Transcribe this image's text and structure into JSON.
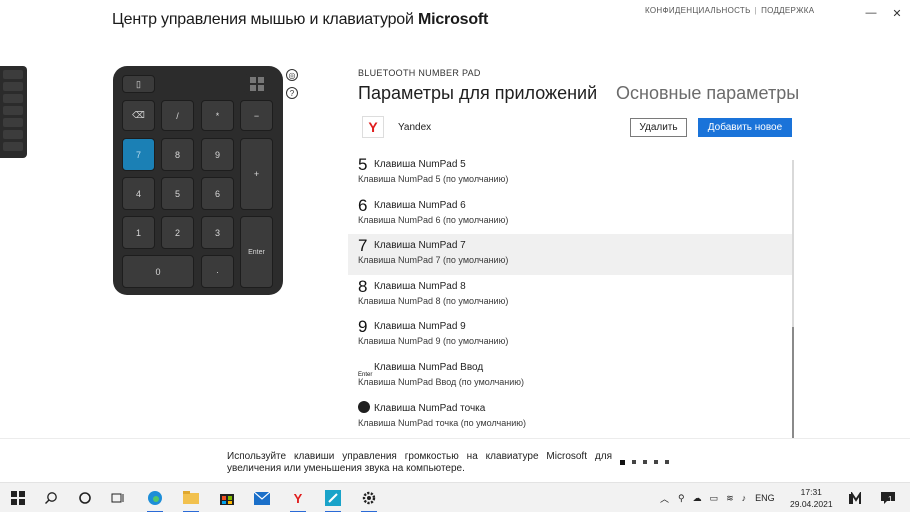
{
  "window": {
    "title_prefix": "Центр управления мышью и клавиатурой",
    "title_brand": "Microsoft",
    "link_privacy": "КОНФИДЕНЦИАЛЬНОСТЬ",
    "link_support": "ПОДДЕРЖКА",
    "min_glyph": "—",
    "close_glyph": "✕"
  },
  "device": {
    "name": "BLUETOOTH NUMBER PAD",
    "keys": {
      "backspace": "⌫",
      "divide": "/",
      "multiply": "*",
      "minus": "−",
      "k7": "7",
      "k8": "8",
      "k9": "9",
      "plus": "+",
      "k4": "4",
      "k5": "5",
      "k6": "6",
      "k1": "1",
      "k2": "2",
      "k3": "3",
      "enter": "Enter",
      "k0": "0",
      "dot": "·"
    },
    "settings_icon": "◎",
    "help_icon": "?"
  },
  "tabs": {
    "apps": "Параметры для приложений",
    "basic": "Основные параметры"
  },
  "app_row": {
    "icon_letter": "Y",
    "name": "Yandex",
    "delete_label": "Удалить",
    "add_label": "Добавить новое"
  },
  "key_list": [
    {
      "glyph": "5",
      "title": "Клавиша NumPad 5",
      "subtitle": "Клавиша NumPad 5 (по умолчанию)"
    },
    {
      "glyph": "6",
      "title": "Клавиша NumPad 6",
      "subtitle": "Клавиша NumPad 6 (по умолчанию)"
    },
    {
      "glyph": "7",
      "title": "Клавиша NumPad 7",
      "subtitle": "Клавиша NumPad 7 (по умолчанию)"
    },
    {
      "glyph": "8",
      "title": "Клавиша NumPad 8",
      "subtitle": "Клавиша NumPad 8 (по умолчанию)"
    },
    {
      "glyph": "9",
      "title": "Клавиша NumPad 9",
      "subtitle": "Клавиша NumPad 9 (по умолчанию)"
    },
    {
      "glyph": "Enter",
      "title": "Клавиша NumPad Ввод",
      "subtitle": "Клавиша NumPad Ввод (по умолчанию)"
    },
    {
      "glyph": "",
      "title": "Клавиша NumPad точка",
      "subtitle": "Клавиша NumPad точка (по умолчанию)"
    }
  ],
  "footer": {
    "tip": "Используйте клавиши управления громкостью на клавиатуре Microsoft для увеличения или уменьшения звука на компьютере."
  },
  "taskbar": {
    "language": "ENG",
    "time": "17:31",
    "date": "29.04.2021",
    "notification_count": "1"
  },
  "colors": {
    "accent": "#1a73d9",
    "active_key": "#1b80b5",
    "device_body": "#2c2c2c"
  }
}
